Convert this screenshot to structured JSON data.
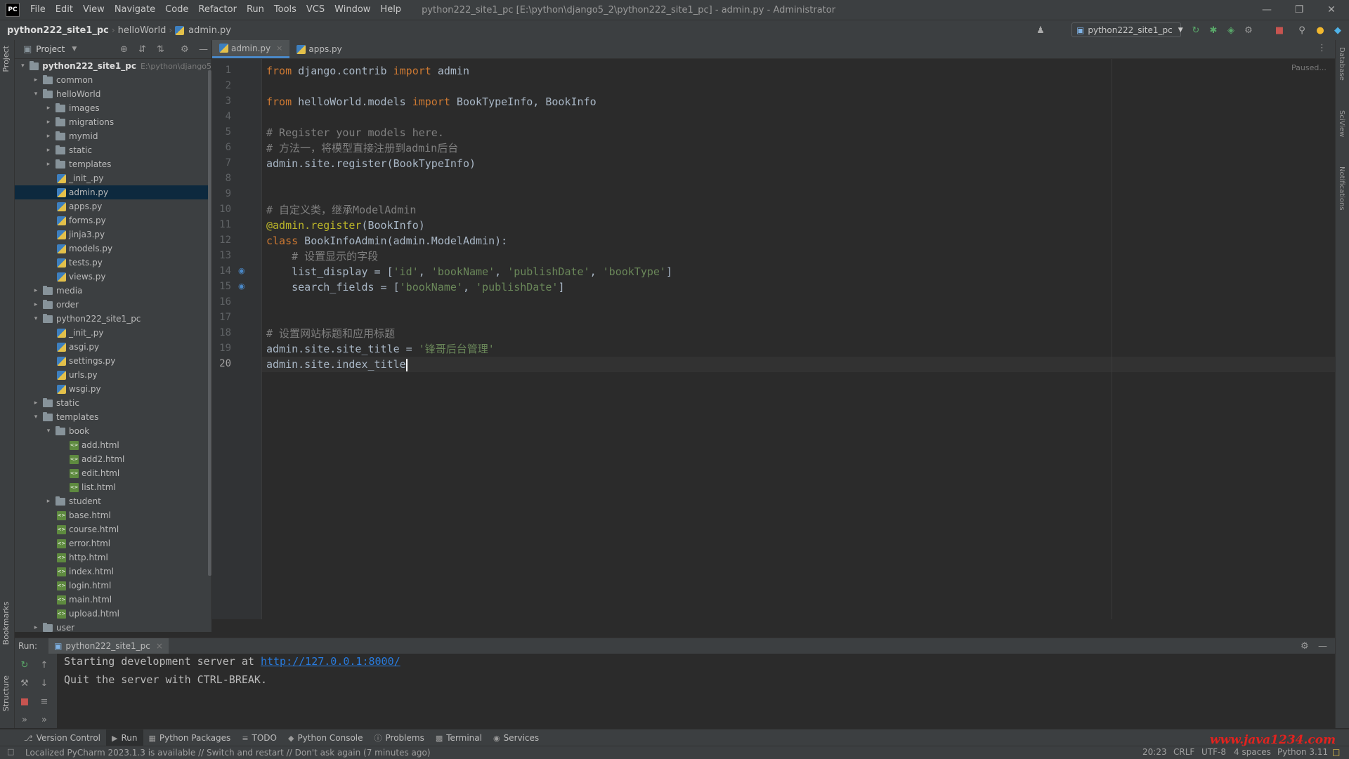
{
  "app": {
    "logo_text": "PC",
    "menu": [
      "File",
      "Edit",
      "View",
      "Navigate",
      "Code",
      "Refactor",
      "Run",
      "Tools",
      "VCS",
      "Window",
      "Help"
    ],
    "window_title": "python222_site1_pc [E:\\python\\django5_2\\python222_site1_pc] - admin.py - Administrator"
  },
  "breadcrumb": [
    "python222_site1_pc",
    "helloWorld",
    "admin.py"
  ],
  "run_config": {
    "label": "python222_site1_pc"
  },
  "left_stripe": {
    "project": "Project",
    "bookmarks": "Bookmarks",
    "structure": "Structure"
  },
  "right_stripe": {
    "database": "Database",
    "sciview": "SciView",
    "notifications": "Notifications"
  },
  "project_panel": {
    "title": "Project",
    "tree": [
      {
        "label": "python222_site1_pc",
        "type": "folder",
        "depth": 0,
        "open": true,
        "bold": true,
        "hint": "E:\\python\\django5"
      },
      {
        "label": "common",
        "type": "folder",
        "depth": 1,
        "open": false
      },
      {
        "label": "helloWorld",
        "type": "folder",
        "depth": 1,
        "open": true
      },
      {
        "label": "images",
        "type": "folder",
        "depth": 2,
        "open": false
      },
      {
        "label": "migrations",
        "type": "folder",
        "depth": 2,
        "open": false
      },
      {
        "label": "mymid",
        "type": "folder",
        "depth": 2,
        "open": false
      },
      {
        "label": "static",
        "type": "folder",
        "depth": 2,
        "open": false
      },
      {
        "label": "templates",
        "type": "folder",
        "depth": 2,
        "open": false
      },
      {
        "label": "_init_.py",
        "type": "py",
        "depth": 3
      },
      {
        "label": "admin.py",
        "type": "py",
        "depth": 3,
        "selected": true
      },
      {
        "label": "apps.py",
        "type": "py",
        "depth": 3
      },
      {
        "label": "forms.py",
        "type": "py",
        "depth": 3
      },
      {
        "label": "jinja3.py",
        "type": "py",
        "depth": 3
      },
      {
        "label": "models.py",
        "type": "py",
        "depth": 3
      },
      {
        "label": "tests.py",
        "type": "py",
        "depth": 3
      },
      {
        "label": "views.py",
        "type": "py",
        "depth": 3
      },
      {
        "label": "media",
        "type": "folder",
        "depth": 1,
        "open": false
      },
      {
        "label": "order",
        "type": "folder",
        "depth": 1,
        "open": false
      },
      {
        "label": "python222_site1_pc",
        "type": "folder",
        "depth": 1,
        "open": true
      },
      {
        "label": "_init_.py",
        "type": "py",
        "depth": 3
      },
      {
        "label": "asgi.py",
        "type": "py",
        "depth": 3
      },
      {
        "label": "settings.py",
        "type": "py",
        "depth": 3
      },
      {
        "label": "urls.py",
        "type": "py",
        "depth": 3
      },
      {
        "label": "wsgi.py",
        "type": "py",
        "depth": 3
      },
      {
        "label": "static",
        "type": "folder",
        "depth": 1,
        "open": false
      },
      {
        "label": "templates",
        "type": "folder",
        "depth": 1,
        "open": true
      },
      {
        "label": "book",
        "type": "folder",
        "depth": 2,
        "open": true
      },
      {
        "label": "add.html",
        "type": "html",
        "depth": 4
      },
      {
        "label": "add2.html",
        "type": "html",
        "depth": 4
      },
      {
        "label": "edit.html",
        "type": "html",
        "depth": 4
      },
      {
        "label": "list.html",
        "type": "html",
        "depth": 4
      },
      {
        "label": "student",
        "type": "folder",
        "depth": 2,
        "open": false
      },
      {
        "label": "base.html",
        "type": "html",
        "depth": 3
      },
      {
        "label": "course.html",
        "type": "html",
        "depth": 3
      },
      {
        "label": "error.html",
        "type": "html",
        "depth": 3
      },
      {
        "label": "http.html",
        "type": "html",
        "depth": 3
      },
      {
        "label": "index.html",
        "type": "html",
        "depth": 3
      },
      {
        "label": "login.html",
        "type": "html",
        "depth": 3
      },
      {
        "label": "main.html",
        "type": "html",
        "depth": 3
      },
      {
        "label": "upload.html",
        "type": "html",
        "depth": 3
      },
      {
        "label": "user",
        "type": "folder",
        "depth": 1,
        "open": false
      }
    ]
  },
  "editor": {
    "tabs": [
      {
        "label": "admin.py",
        "active": true
      },
      {
        "label": "apps.py",
        "active": false
      }
    ],
    "status_hint": "Paused...",
    "current_line": 20,
    "lines": [
      [
        [
          "kw",
          "from"
        ],
        [
          "",
          " django.contrib "
        ],
        [
          "kw",
          "import"
        ],
        [
          "",
          " admin"
        ]
      ],
      [],
      [
        [
          "kw",
          "from"
        ],
        [
          "",
          " helloWorld.models "
        ],
        [
          "kw",
          "import"
        ],
        [
          "",
          " BookTypeInfo, BookInfo"
        ]
      ],
      [],
      [
        [
          "cmt",
          "# Register your models here."
        ]
      ],
      [
        [
          "cmt",
          "# 方法一，将模型直接注册到admin后台"
        ]
      ],
      [
        [
          "",
          "admin.site.register(BookTypeInfo)"
        ]
      ],
      [],
      [],
      [
        [
          "cmt",
          "# 自定义类，继承ModelAdmin"
        ]
      ],
      [
        [
          "dec",
          "@admin.register"
        ],
        [
          "",
          "(BookInfo)"
        ]
      ],
      [
        [
          "kw",
          "class"
        ],
        [
          "",
          " BookInfoAdmin(admin.ModelAdmin):"
        ]
      ],
      [
        [
          "cmt",
          "    # 设置显示的字段"
        ]
      ],
      [
        [
          "",
          "    list_display = ["
        ],
        [
          "str",
          "'id'"
        ],
        [
          "",
          ", "
        ],
        [
          "str",
          "'bookName'"
        ],
        [
          "",
          ", "
        ],
        [
          "str",
          "'publishDate'"
        ],
        [
          "",
          ", "
        ],
        [
          "str",
          "'bookType'"
        ],
        [
          "",
          "]"
        ]
      ],
      [
        [
          "",
          "    search_fields = ["
        ],
        [
          "str",
          "'bookName'"
        ],
        [
          "",
          ", "
        ],
        [
          "str",
          "'publishDate'"
        ],
        [
          "",
          "]"
        ]
      ],
      [],
      [],
      [
        [
          "cmt",
          "# 设置网站标题和应用标题"
        ]
      ],
      [
        [
          "",
          "admin.site.site_title = "
        ],
        [
          "str",
          "'锋哥后台管理'"
        ]
      ],
      [
        [
          "",
          "admin.site.index_title"
        ]
      ]
    ]
  },
  "run_panel": {
    "label": "Run:",
    "tab": "python222_site1_pc",
    "console": {
      "line1_prefix": "Starting development server at ",
      "line1_link": "http://127.0.0.1:8000/",
      "line2": "Quit the server with CTRL-BREAK."
    }
  },
  "bottom_tools": [
    "Version Control",
    "Run",
    "Python Packages",
    "TODO",
    "Python Console",
    "Problems",
    "Terminal",
    "Services"
  ],
  "status_bar": {
    "message": "Localized PyCharm 2023.1.3 is available // Switch and restart // Don't ask again (7 minutes ago)",
    "position": "20:23",
    "line_sep": "CRLF",
    "encoding": "UTF-8",
    "indent": "4 spaces",
    "interpreter": "Python 3.11"
  },
  "watermark": "www.java1234.com"
}
